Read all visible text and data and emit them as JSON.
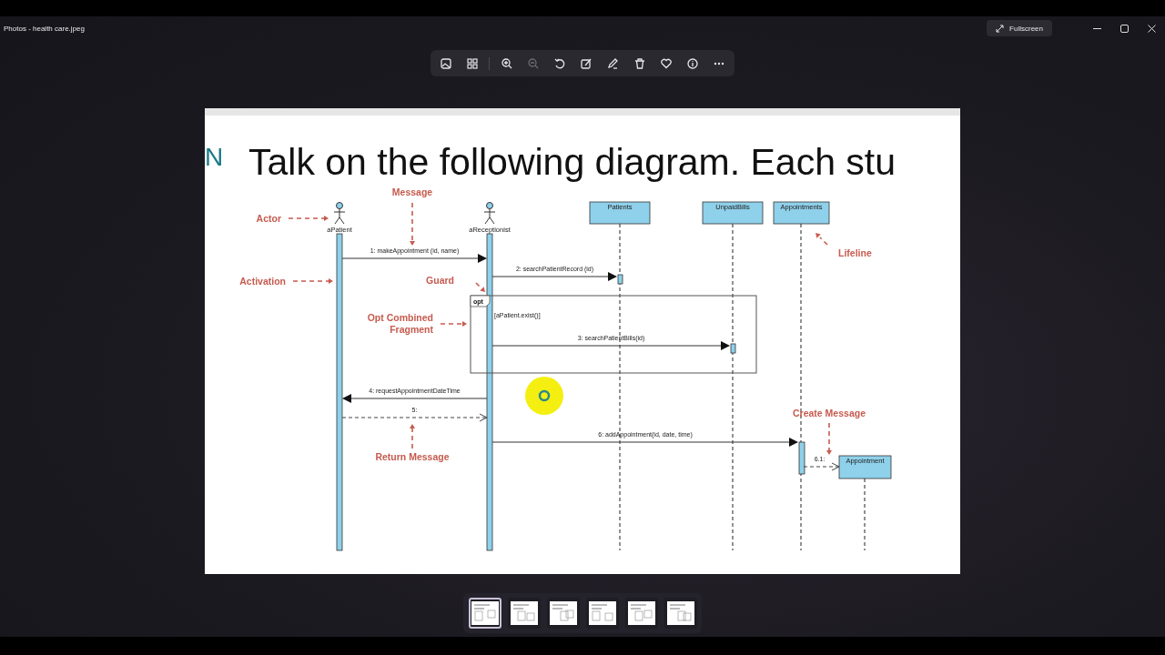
{
  "window": {
    "title": "Photos - health care.jpeg"
  },
  "toolbar": [
    {
      "kind": "image",
      "disabled": false
    },
    {
      "kind": "gallery",
      "disabled": false
    },
    {
      "kind": "zoom-in",
      "disabled": false
    },
    {
      "kind": "zoom-out",
      "disabled": true
    },
    {
      "kind": "rotate",
      "disabled": false
    },
    {
      "kind": "edit",
      "disabled": false
    },
    {
      "kind": "draw",
      "disabled": false
    },
    {
      "kind": "delete",
      "disabled": false
    },
    {
      "kind": "favorite",
      "disabled": false
    },
    {
      "kind": "info",
      "disabled": false
    },
    {
      "kind": "more",
      "disabled": false
    }
  ],
  "fullscreen_button": {
    "label": "Fullscreen"
  },
  "slide": {
    "title_fragment": "N",
    "title": "Talk on the following diagram. Each stu",
    "participants": [
      {
        "kind": "actor",
        "name": "aPatient"
      },
      {
        "kind": "actor",
        "name": "aReceptionist"
      },
      {
        "kind": "object",
        "name": "Patients"
      },
      {
        "kind": "object",
        "name": "UnpaidBills"
      },
      {
        "kind": "object",
        "name": "Appointments"
      },
      {
        "kind": "object",
        "name": "Appointment"
      }
    ],
    "fragment": {
      "operator": "opt",
      "guard": "[aPatient.exist()]"
    },
    "messages": [
      {
        "label": "1: makeAppointment (id, name)",
        "kind": "call"
      },
      {
        "label": "2: searchPatientRecord (id)",
        "kind": "call"
      },
      {
        "label": "3: searchPatientBills(id)",
        "kind": "call"
      },
      {
        "label": "4: requestAppointmentDateTime",
        "kind": "call"
      },
      {
        "label": "5:",
        "kind": "return"
      },
      {
        "label": "6: addAppointment(id, date, time)",
        "kind": "call"
      },
      {
        "label": "6.1:",
        "kind": "create"
      }
    ],
    "annotations": [
      {
        "lines": [
          "Message"
        ]
      },
      {
        "lines": [
          "Actor"
        ]
      },
      {
        "lines": [
          "Activation"
        ]
      },
      {
        "lines": [
          "Guard"
        ]
      },
      {
        "lines": [
          "Opt Combined",
          "Fragment"
        ]
      },
      {
        "lines": [
          "Lifeline"
        ]
      },
      {
        "lines": [
          "Create Message"
        ]
      },
      {
        "lines": [
          "Return Message"
        ]
      }
    ]
  },
  "thumbnails": [
    {
      "selected": true
    },
    {
      "selected": false
    },
    {
      "selected": false
    },
    {
      "selected": false
    },
    {
      "selected": false
    },
    {
      "selected": false
    }
  ]
}
